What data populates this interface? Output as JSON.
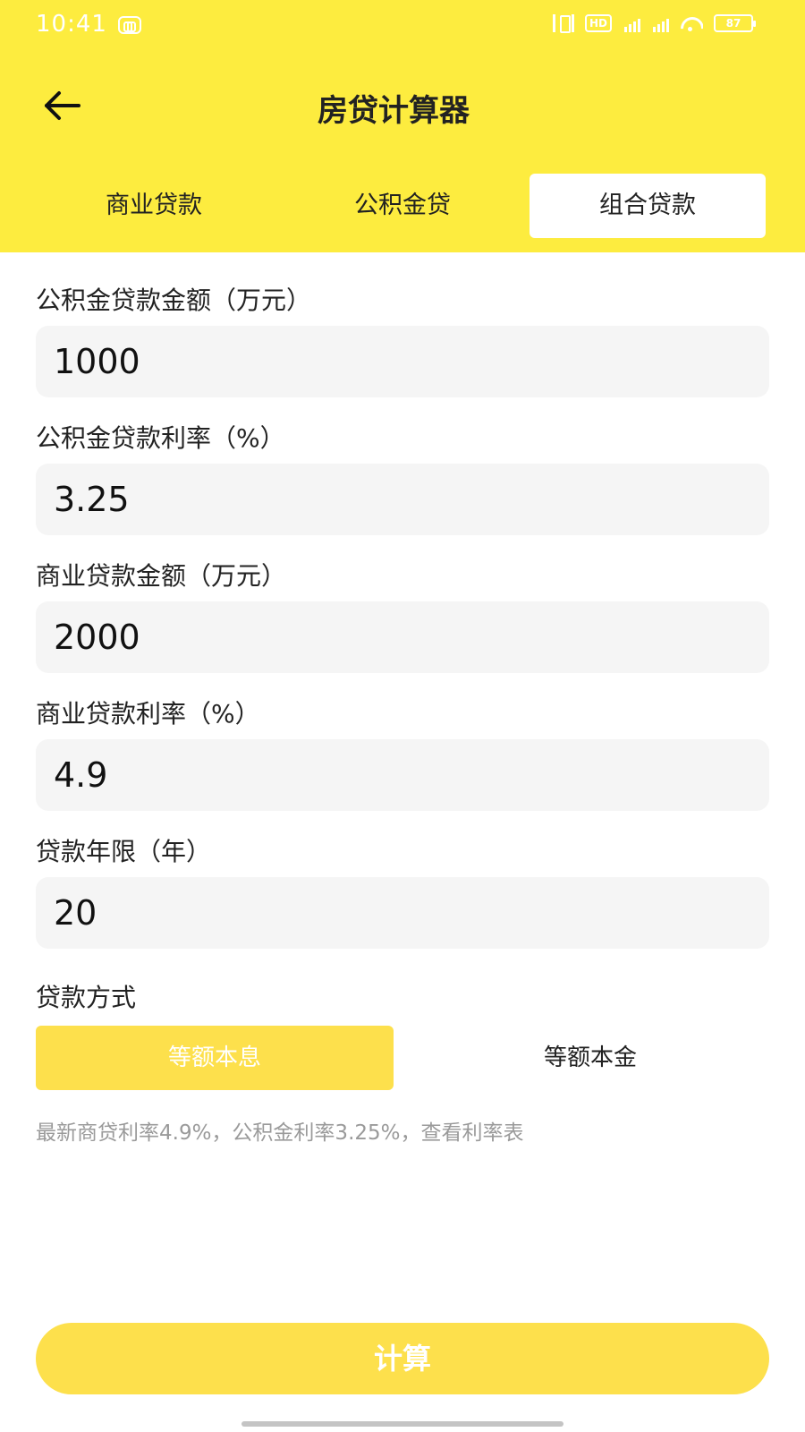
{
  "status_bar": {
    "time": "10:41",
    "battery": "87",
    "hd_label": "HD"
  },
  "header": {
    "title": "房贷计算器",
    "back_icon": "arrow-left-icon",
    "background_color": "#FDEC3F"
  },
  "tabs": [
    {
      "label": "商业贷款",
      "active": false
    },
    {
      "label": "公积金贷",
      "active": false
    },
    {
      "label": "组合贷款",
      "active": true
    }
  ],
  "form": {
    "fund_amount": {
      "label": "公积金贷款金额（万元）",
      "value": "1000"
    },
    "fund_rate": {
      "label": "公积金贷款利率（%）",
      "value": "3.25"
    },
    "commercial_amount": {
      "label": "商业贷款金额（万元）",
      "value": "2000"
    },
    "commercial_rate": {
      "label": "商业贷款利率（%）",
      "value": "4.9"
    },
    "term_years": {
      "label": "贷款年限（年）",
      "value": "20"
    }
  },
  "repayment_method": {
    "label": "贷款方式",
    "options": [
      {
        "label": "等额本息",
        "selected": true
      },
      {
        "label": "等额本金",
        "selected": false
      }
    ]
  },
  "rate_note": "最新商贷利率4.9%，公积金利率3.25%，查看利率表",
  "calculate_button": "计算",
  "accent_color": "#FDE04C"
}
